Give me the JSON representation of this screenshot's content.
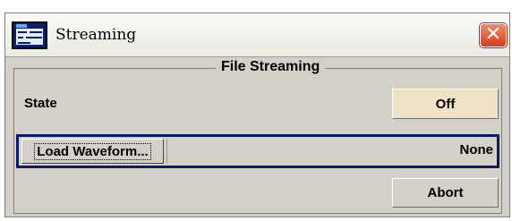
{
  "window": {
    "title": "Streaming",
    "close_symbol": "✕"
  },
  "group": {
    "legend": "File Streaming"
  },
  "state": {
    "label": "State",
    "button_label": "Off"
  },
  "load": {
    "button_label": "Load Waveform...",
    "file_value": "None"
  },
  "abort": {
    "button_label": "Abort"
  },
  "colors": {
    "focus_frame": "#091a68",
    "off_button": "#f1e1c6",
    "close_button": "#d4401f",
    "dialog_background": "#d4d0c8"
  }
}
